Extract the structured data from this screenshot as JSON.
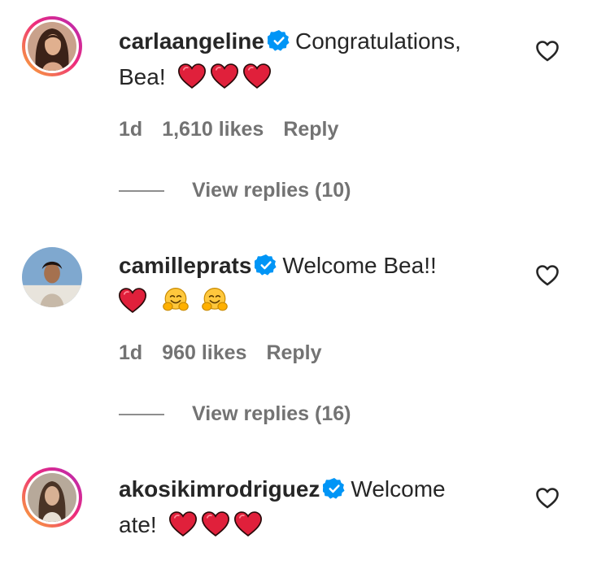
{
  "comments": [
    {
      "username": "carlaangeline",
      "text_line1": "Congratulations,",
      "text_line2": "Bea!",
      "time": "1d",
      "likes": "1,610 likes",
      "reply": "Reply",
      "view_replies": "View replies (10)"
    },
    {
      "username": "camilleprats",
      "text_line1": "Welcome Bea!!",
      "time": "1d",
      "likes": "960 likes",
      "reply": "Reply",
      "view_replies": "View replies (16)"
    },
    {
      "username": "akosikimrodriguez",
      "text_line1": "Welcome",
      "text_line2": "ate!"
    }
  ],
  "colors": {
    "text": "#262626",
    "meta": "#737373",
    "verified": "#0095f6",
    "heart": "#e0203b",
    "story_ring_start": "#f9b233",
    "story_ring_end": "#b12ab8"
  },
  "icons": [
    "verified-badge-icon",
    "red-heart-emoji",
    "hugging-face-emoji",
    "heart-outline-icon"
  ]
}
